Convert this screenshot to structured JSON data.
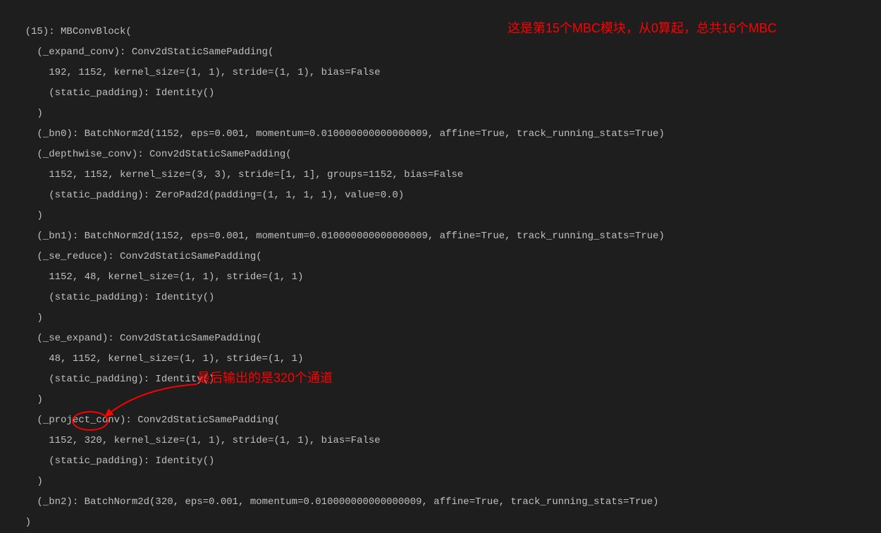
{
  "code": {
    "l01": "    (15): MBConvBlock(",
    "l02": "      (_expand_conv): Conv2dStaticSamePadding(",
    "l03": "        192, 1152, kernel_size=(1, 1), stride=(1, 1), bias=False",
    "l04": "        (static_padding): Identity()",
    "l05": "      )",
    "l06": "      (_bn0): BatchNorm2d(1152, eps=0.001, momentum=0.010000000000000009, affine=True, track_running_stats=True)",
    "l07": "      (_depthwise_conv): Conv2dStaticSamePadding(",
    "l08": "        1152, 1152, kernel_size=(3, 3), stride=[1, 1], groups=1152, bias=False",
    "l09": "        (static_padding): ZeroPad2d(padding=(1, 1, 1, 1), value=0.0)",
    "l10": "      )",
    "l11": "      (_bn1): BatchNorm2d(1152, eps=0.001, momentum=0.010000000000000009, affine=True, track_running_stats=True)",
    "l12": "      (_se_reduce): Conv2dStaticSamePadding(",
    "l13": "        1152, 48, kernel_size=(1, 1), stride=(1, 1)",
    "l14": "        (static_padding): Identity()",
    "l15": "      )",
    "l16": "      (_se_expand): Conv2dStaticSamePadding(",
    "l17": "        48, 1152, kernel_size=(1, 1), stride=(1, 1)",
    "l18": "        (static_padding): Identity()",
    "l19": "      )",
    "l20": "      (_project_conv): Conv2dStaticSamePadding(",
    "l21": "        1152, 320, kernel_size=(1, 1), stride=(1, 1), bias=False",
    "l22": "        (static_padding): Identity()",
    "l23": "      )",
    "l24": "      (_bn2): BatchNorm2d(320, eps=0.001, momentum=0.010000000000000009, affine=True, track_running_stats=True)",
    "l25": "    )"
  },
  "annotations": {
    "top": "这是第15个MBC模块，从0算起，总共16个MBC",
    "mid": "最后输出的是320个通道"
  }
}
